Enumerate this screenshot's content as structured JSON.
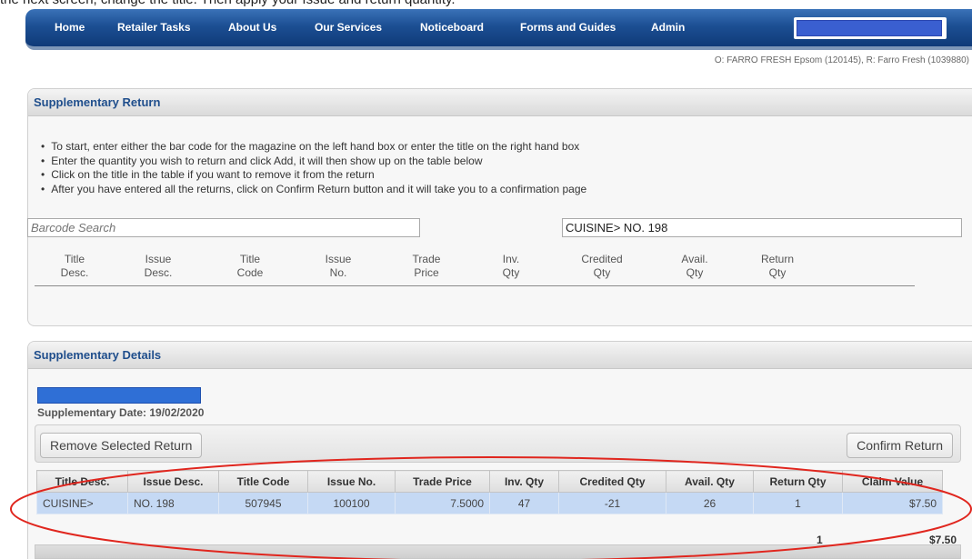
{
  "caption": "the next screen, change the title. Then apply your Issue and return quantity.",
  "nav": {
    "items": [
      "Home",
      "Retailer Tasks",
      "About Us",
      "Our Services",
      "Noticeboard",
      "Forms and Guides",
      "Admin"
    ]
  },
  "user_info": "O: FARRO FRESH Epsom (120145), R: Farro Fresh (1039880)",
  "supplementary_return": {
    "header": "Supplementary Return",
    "instructions": [
      "To start, enter either the bar code for the magazine on the left hand box or enter the title on the right hand box",
      "Enter the quantity you wish to return and click Add, it will then show up on the table below",
      "Click on the title in the table if you want to remove it from the return",
      "After you have entered all the returns, click on Confirm Return button and it will take you to a confirmation page"
    ],
    "barcode_placeholder": "Barcode Search",
    "title_value": "CUISINE> NO. 198",
    "columns": [
      [
        "Title",
        "Desc."
      ],
      [
        "Issue",
        "Desc."
      ],
      [
        "Title",
        "Code"
      ],
      [
        "Issue",
        "No."
      ],
      [
        "Trade",
        "Price"
      ],
      [
        "Inv.",
        "Qty"
      ],
      [
        "Credited",
        "Qty"
      ],
      [
        "Avail.",
        "Qty"
      ],
      [
        "Return",
        "Qty"
      ]
    ]
  },
  "supplementary_details": {
    "header": "Supplementary Details",
    "date_label": "Supplementary Date: 19/02/2020",
    "remove_button": "Remove Selected Return",
    "confirm_button": "Confirm Return",
    "table": {
      "headers": [
        "Title Desc.",
        "Issue Desc.",
        "Title Code",
        "Issue No.",
        "Trade Price",
        "Inv. Qty",
        "Credited Qty",
        "Avail. Qty",
        "Return Qty",
        "Claim Value"
      ],
      "rows": [
        [
          "CUISINE>",
          "NO. 198",
          "507945",
          "100100",
          "7.5000",
          "47",
          "-21",
          "26",
          "1",
          "$7.50"
        ]
      ]
    },
    "footer_count": "1",
    "footer_total": "$7.50"
  },
  "colors": {
    "nav_blue": "#1c4f93",
    "header_text": "#1f4e8c",
    "row_highlight": "#c5d9f4",
    "redaction": "#3a5fd0",
    "annotation": "#e0261e"
  }
}
